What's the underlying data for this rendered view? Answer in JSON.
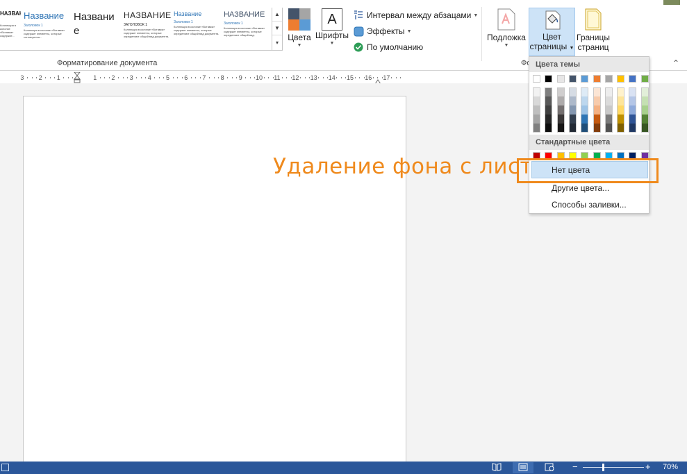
{
  "ribbon": {
    "styles_gallery": [
      {
        "title": "НАЗВАНИЕ",
        "sub": "",
        "body": "Коллекция в колонке «Вставка» содержит..."
      },
      {
        "title": "Название",
        "sub": "Заголовок 1",
        "body": "Коллекция в колонке «Вставка» содержит элементы, которые согласуются..."
      },
      {
        "title": "Названи е",
        "sub": "",
        "body": ""
      },
      {
        "title": "НАЗВАНИЕ",
        "sub": "ЗАГОЛОВОК 1",
        "body": "Коллекция в колонке «Вставка» содержит элементы, которые определяют общий вид документа."
      },
      {
        "title": "Название",
        "sub": "Заголовок 1",
        "body": "Коллекция в колонке «Вставка» содержит элементы, которые определяют общий вид документа."
      },
      {
        "title": "НАЗВАНИЕ",
        "sub": "Заголовок 1",
        "body": "Коллекция в колонке «Вставка» содержит элементы, которые определяют общий вид."
      }
    ],
    "group_format_label": "Форматирование документа",
    "colors_label": "Цвета",
    "fonts_label": "Шрифты",
    "paragraph_spacing_label": "Интервал между абзацами",
    "effects_label": "Эффекты",
    "default_label": "По умолчанию",
    "watermark_label": "Подложка",
    "page_color_label_1": "Цвет",
    "page_color_label_2": "страницы",
    "page_borders_label_1": "Границы",
    "page_borders_label_2": "страниц",
    "group_bg_label": "Фо"
  },
  "ruler": {
    "labels": [
      "3",
      "2",
      "1",
      "1",
      "2",
      "3",
      "4",
      "5",
      "6",
      "7",
      "8",
      "9",
      "10",
      "11",
      "12",
      "13",
      "14",
      "15",
      "16",
      "17"
    ]
  },
  "page_color_menu": {
    "theme_header": "Цвета темы",
    "standard_header": "Стандартные цвета",
    "no_color": "Нет цвета",
    "more_colors": "Другие цвета...",
    "fill_effects": "Способы заливки...",
    "theme_top_row": [
      "#ffffff",
      "#000000",
      "#e7e6e6",
      "#44546a",
      "#5b9bd5",
      "#ed7d31",
      "#a5a5a5",
      "#ffc000",
      "#4472c4",
      "#70ad47"
    ],
    "theme_shades": [
      [
        "#f2f2f2",
        "#d9d9d9",
        "#bfbfbf",
        "#a6a6a6",
        "#808080"
      ],
      [
        "#7f7f7f",
        "#595959",
        "#404040",
        "#262626",
        "#0d0d0d"
      ],
      [
        "#d0cece",
        "#aeabab",
        "#757070",
        "#3b3838",
        "#171616"
      ],
      [
        "#d6dce4",
        "#adb9ca",
        "#8497b0",
        "#333f4f",
        "#222a35"
      ],
      [
        "#deebf6",
        "#bdd7ee",
        "#9dc3e6",
        "#2e75b5",
        "#1f4e79"
      ],
      [
        "#fbe5d5",
        "#f7cbac",
        "#f4b183",
        "#c55a11",
        "#833c0b"
      ],
      [
        "#ededed",
        "#dbdbdb",
        "#c9c9c9",
        "#7b7b7b",
        "#525252"
      ],
      [
        "#fff2cc",
        "#fee599",
        "#ffd965",
        "#bf9000",
        "#7f6000"
      ],
      [
        "#d9e2f3",
        "#b4c6e7",
        "#8eaadb",
        "#2f5496",
        "#1f3864"
      ],
      [
        "#e2efd9",
        "#c5e0b3",
        "#a8d08d",
        "#538135",
        "#375623"
      ]
    ],
    "standard_colors": [
      "#c00000",
      "#ff0000",
      "#ffc000",
      "#ffff00",
      "#92d050",
      "#00b050",
      "#00b0f0",
      "#0070c0",
      "#002060",
      "#7030a0"
    ]
  },
  "annotation": {
    "text": "Удаление фона с листа",
    "color": "#ef8a1d"
  },
  "status_bar": {
    "zoom_percent": "70%",
    "zoom_minus": "−",
    "zoom_plus": "+",
    "color": "#2b579a"
  }
}
